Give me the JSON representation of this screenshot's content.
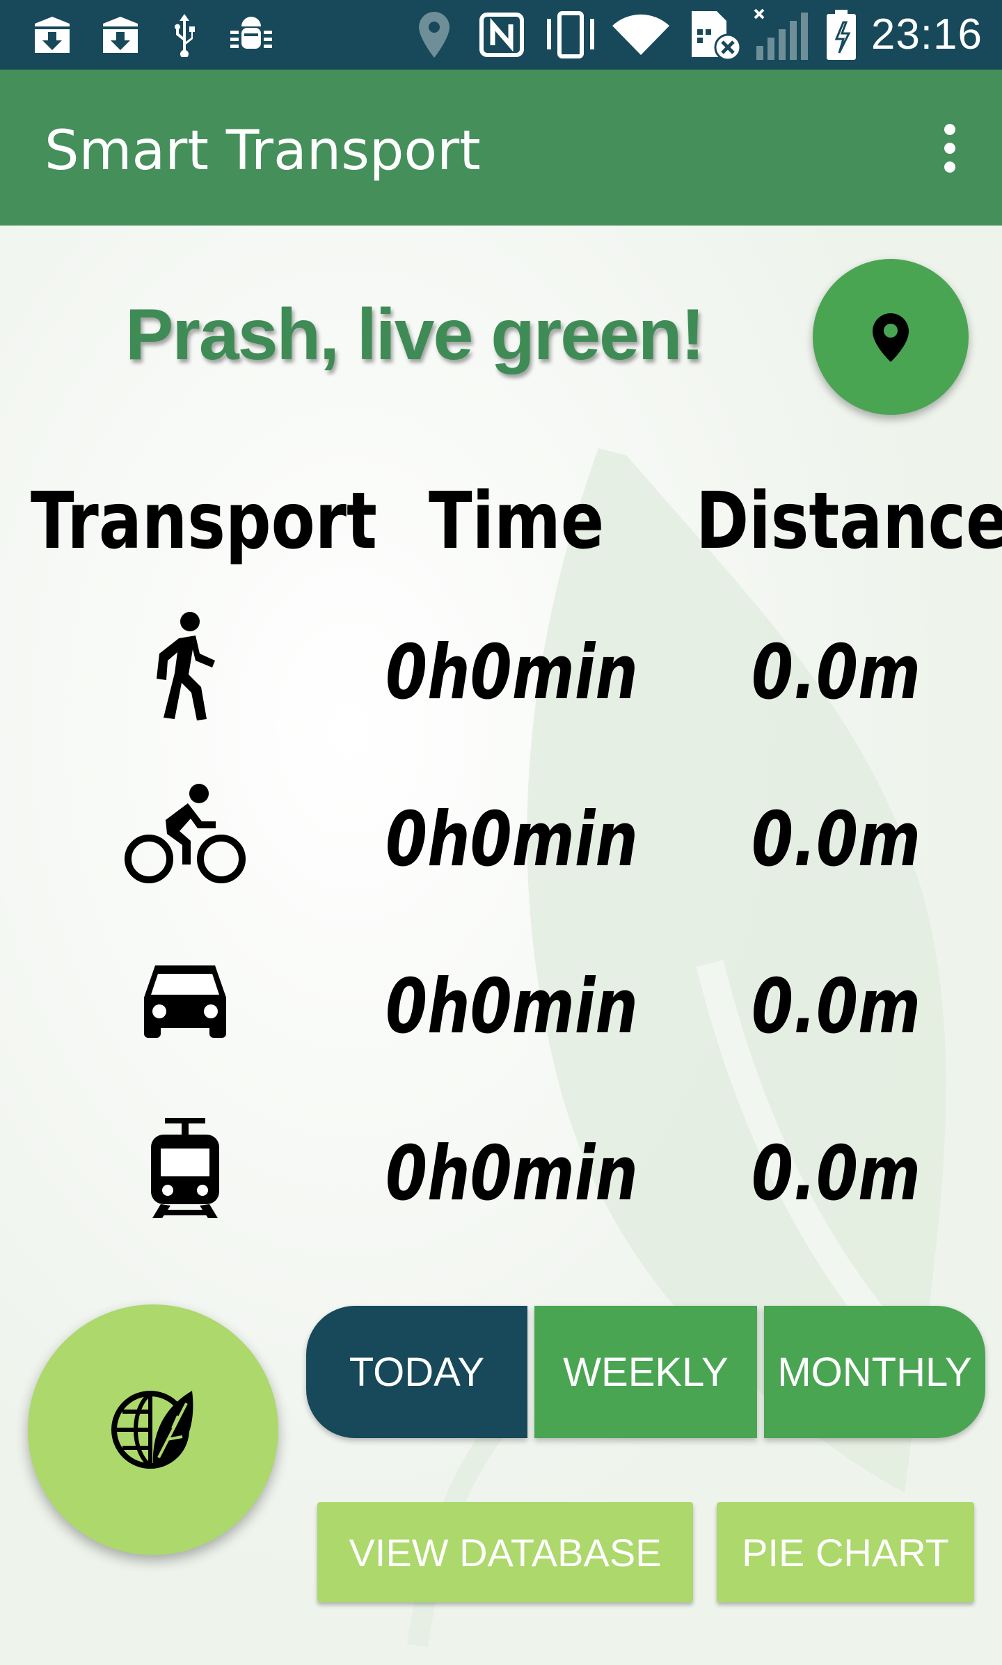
{
  "status_bar": {
    "time": "23:16",
    "icons": [
      "download-icon",
      "download-icon",
      "usb-icon",
      "android-debug-icon",
      "location-icon",
      "nfc-icon",
      "vibrate-icon",
      "wifi-icon",
      "sim-disabled-icon",
      "signal-icon",
      "battery-charging-icon"
    ]
  },
  "app_bar": {
    "title": "Smart Transport",
    "menu_icon": "more-vert-icon"
  },
  "greeting": "Prash, live green!",
  "location_button_icon": "location-pin-icon",
  "table": {
    "headers": [
      "Transport",
      "Time",
      "Distance"
    ],
    "rows": [
      {
        "mode_icon": "walk-icon",
        "time": "0h0min",
        "distance": "0.0m"
      },
      {
        "mode_icon": "bike-icon",
        "time": "0h0min",
        "distance": "0.0m"
      },
      {
        "mode_icon": "car-icon",
        "time": "0h0min",
        "distance": "0.0m"
      },
      {
        "mode_icon": "tram-icon",
        "time": "0h0min",
        "distance": "0.0m"
      }
    ]
  },
  "eco_button_icon": "eco-globe-leaf-icon",
  "period_tabs": [
    "TODAY",
    "WEEKLY",
    "MONTHLY"
  ],
  "selected_period": "TODAY",
  "actions": {
    "view_database": "VIEW DATABASE",
    "pie_chart": "PIE CHART"
  },
  "colors": {
    "status_bar": "#17495a",
    "app_bar": "#458f5a",
    "accent_green": "#4aa553",
    "light_green": "#acd86c",
    "selected_tab": "#17495a",
    "greeting_text": "#3f8b55"
  }
}
